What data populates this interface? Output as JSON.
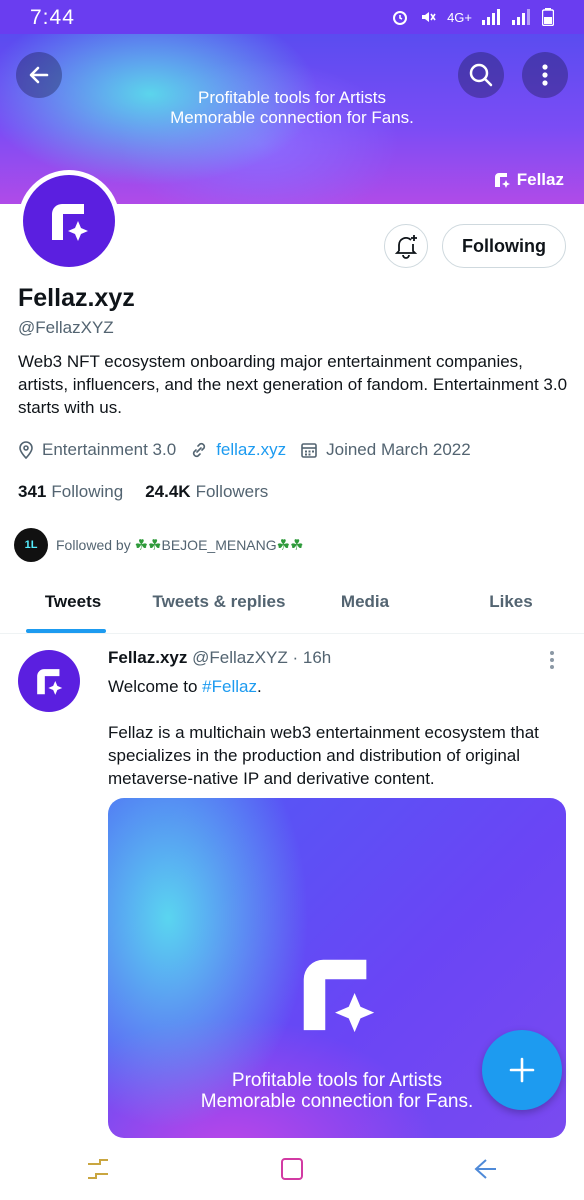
{
  "status_bar": {
    "time": "7:44",
    "network": "4G+"
  },
  "banner": {
    "line1": "Profitable tools for Artists",
    "line2": "Memorable connection for Fans.",
    "brand": "Fellaz"
  },
  "profile": {
    "name": "Fellaz.xyz",
    "handle": "@FellazXYZ",
    "bio": "Web3 NFT ecosystem onboarding major entertainment companies, artists, influencers, and the next generation of fandom. Entertainment 3.0 starts with us.",
    "location": "Entertainment 3.0",
    "website": "fellaz.xyz",
    "joined": "Joined March 2022",
    "following_count": "341",
    "following_label": "Following",
    "followers_count": "24.4K",
    "followers_label": "Followers",
    "followed_by_prefix": "Followed by",
    "followed_by_name": "BEJOE_MENANG",
    "follow_button": "Following"
  },
  "tabs": [
    {
      "label": "Tweets"
    },
    {
      "label": "Tweets & replies"
    },
    {
      "label": "Media"
    },
    {
      "label": "Likes"
    }
  ],
  "tweet": {
    "name": "Fellaz.xyz",
    "handle": "@FellazXYZ",
    "time": "· 16h",
    "text_pre": "Welcome to ",
    "hashtag": "#Fellaz",
    "text_post": ".",
    "body": "Fellaz is a multichain web3 entertainment ecosystem that specializes in the production and distribution of original metaverse-native IP and derivative content.",
    "image_line1": "Profitable tools for Artists",
    "image_line2": "Memorable connection for Fans."
  },
  "colors": {
    "accent": "#1d9bf0",
    "brand_purple": "#5b1fe0"
  }
}
